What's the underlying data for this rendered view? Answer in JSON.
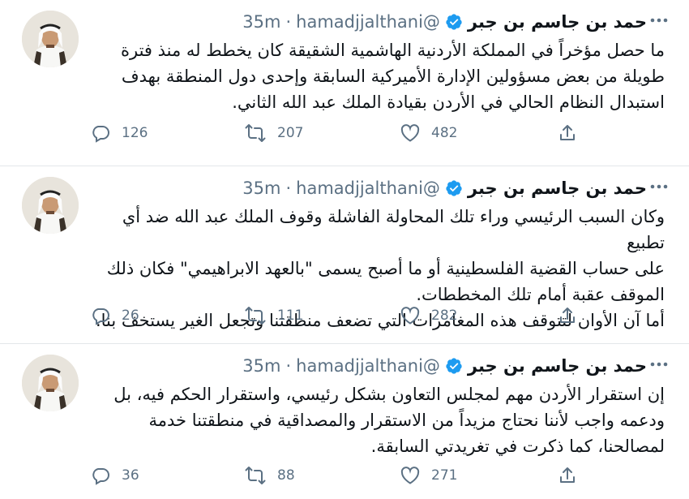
{
  "tweets": [
    {
      "name": "حمد بن جاسم بن جبر",
      "handle": "@hamadjjalthani",
      "dot": "·",
      "time": "35m",
      "lines": [
        "ما حصل مؤخراً في المملكة الأردنية الهاشمية الشقيقة كان يخطط له منذ فترة",
        "طويلة من بعض مسؤولين  الإدارة الأميركية السابقة وإحدى دول المنطقة بهدف",
        "استبدال النظام الحالي في الأردن بقيادة الملك عبد الله الثاني."
      ],
      "replies": "126",
      "retweets": "207",
      "likes": "482"
    },
    {
      "name": "حمد بن جاسم بن جبر",
      "handle": "@hamadjjalthani",
      "dot": "·",
      "time": "35m",
      "lines": [
        "وكان السبب الرئيسي وراء تلك المحاولة الفاشلة وقوف الملك عبد الله ضد أي تطبيع",
        "على حساب القضية الفلسطينية أو ما أصبح يسمى \"بالعهد الابراهيمي\" فكان ذلك",
        "الموقف عقبة أمام تلك المخططات.",
        "أما آن الأوان لتتوقف هذه المغامرات التي تضعف منطقتنا وتجعل الغير يستخف بنا."
      ],
      "replies": "26",
      "retweets": "111",
      "likes": "282"
    },
    {
      "name": "حمد بن جاسم بن جبر",
      "handle": "@hamadjjalthani",
      "dot": "·",
      "time": "35m",
      "lines": [
        "إن استقرار الأردن مهم لمجلس التعاون بشكل رئيسي، واستقرار الحكم فيه، بل",
        "ودعمه واجب لأننا نحتاج مزيداً من الاستقرار والمصداقية في منطقتنا خدمة",
        "لمصالحنا، كما ذكرت في تغريدتي السابقة."
      ],
      "replies": "36",
      "retweets": "88",
      "likes": "271"
    }
  ],
  "icons": {
    "reply": "reply-icon",
    "retweet": "retweet-icon",
    "like": "heart-icon",
    "share": "share-icon",
    "verified": "verified-badge-icon",
    "more": "more-options-icon"
  },
  "colors": {
    "text": "#0f1419",
    "secondary": "#5b7083",
    "verified": "#1d9bf0",
    "divider": "#e3e7ea"
  }
}
